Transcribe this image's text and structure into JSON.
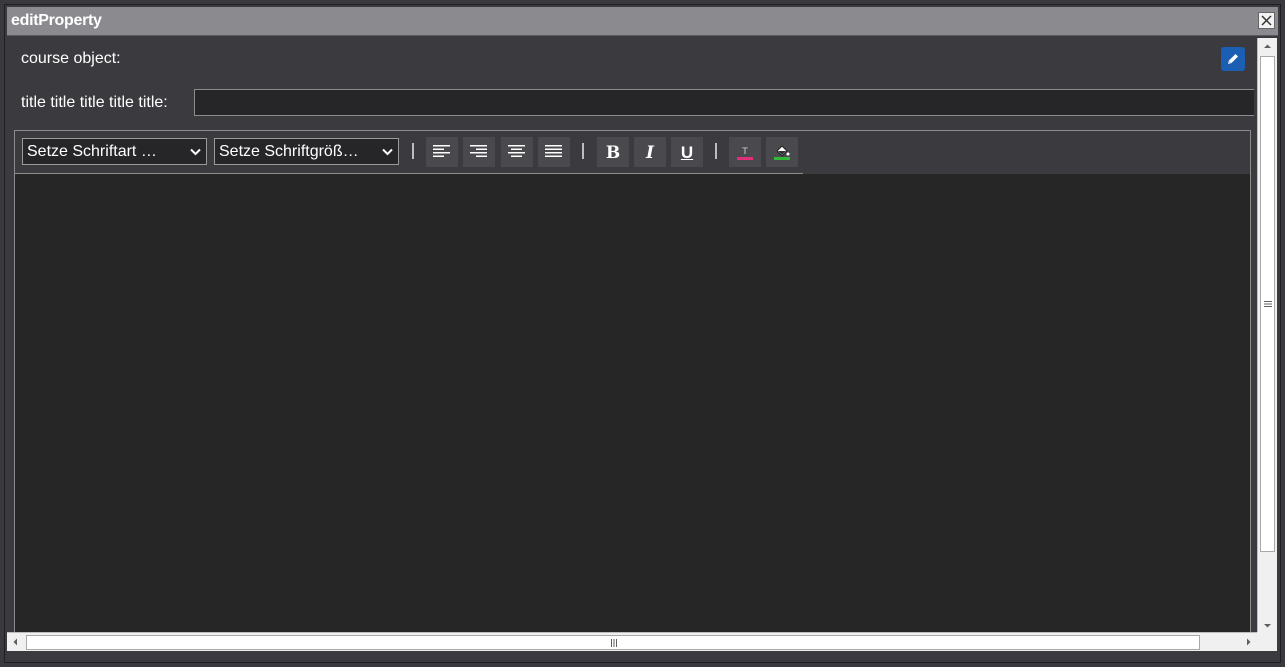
{
  "window": {
    "title": "editProperty"
  },
  "form": {
    "course_object_label": "course object:",
    "title_label": "title title title title title:",
    "title_value": ""
  },
  "toolbar": {
    "font_family_select": "Setze Schriftart …",
    "font_size_select": "Setze Schriftgröß…",
    "align_left_icon": "align-left-icon",
    "align_right_icon": "align-right-icon",
    "align_center_icon": "align-center-icon",
    "align_justify_icon": "align-justify-icon",
    "bold_label": "B",
    "italic_label": "I",
    "underline_label": "U",
    "text_color_accent": "#e0307a",
    "bg_color_accent": "#2fb83a"
  },
  "colors": {
    "titlebar": "#8b8b8f",
    "window_bg": "#3b3b3f",
    "editor_bg": "#262626",
    "edit_button": "#1a5fb4"
  }
}
